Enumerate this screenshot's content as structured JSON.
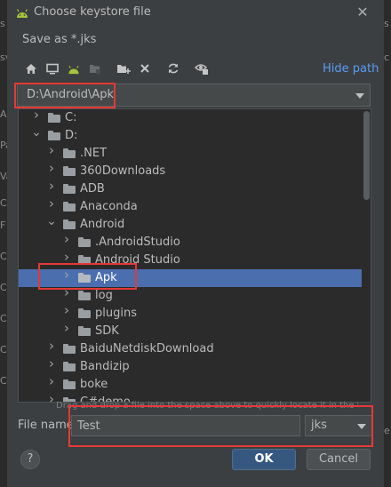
{
  "window": {
    "title": "Choose keystore file",
    "close_icon": "close-icon"
  },
  "subtitle": "Save as *.jks",
  "toolbar": {
    "buttons": [
      "home-icon",
      "desktop-icon",
      "android-icon",
      "module-icon",
      "new-folder-icon",
      "delete-icon",
      "refresh-icon",
      "show-hidden-icon"
    ],
    "hide_path": "Hide path"
  },
  "path": {
    "value": "D:\\Android\\Apk"
  },
  "tree": {
    "items": [
      {
        "label": "C:",
        "depth": 0,
        "expanded": false,
        "selected": false
      },
      {
        "label": "D:",
        "depth": 0,
        "expanded": true,
        "selected": false
      },
      {
        "label": ".NET",
        "depth": 1,
        "expanded": false,
        "selected": false
      },
      {
        "label": "360Downloads",
        "depth": 1,
        "expanded": false,
        "selected": false
      },
      {
        "label": "ADB",
        "depth": 1,
        "expanded": false,
        "selected": false
      },
      {
        "label": "Anaconda",
        "depth": 1,
        "expanded": false,
        "selected": false
      },
      {
        "label": "Android",
        "depth": 1,
        "expanded": true,
        "selected": false
      },
      {
        "label": ".AndroidStudio",
        "depth": 2,
        "expanded": false,
        "selected": false
      },
      {
        "label": "Android Studio",
        "depth": 2,
        "expanded": false,
        "selected": false
      },
      {
        "label": "Apk",
        "depth": 2,
        "expanded": false,
        "selected": true
      },
      {
        "label": "log",
        "depth": 2,
        "expanded": false,
        "selected": false
      },
      {
        "label": "plugins",
        "depth": 2,
        "expanded": false,
        "selected": false
      },
      {
        "label": "SDK",
        "depth": 2,
        "expanded": false,
        "selected": false
      },
      {
        "label": "BaiduNetdiskDownload",
        "depth": 1,
        "expanded": false,
        "selected": false
      },
      {
        "label": "Bandizip",
        "depth": 1,
        "expanded": false,
        "selected": false
      },
      {
        "label": "boke",
        "depth": 1,
        "expanded": false,
        "selected": false
      },
      {
        "label": "C#demo",
        "depth": 1,
        "expanded": false,
        "selected": false
      }
    ]
  },
  "hint": "Drag and drop a file into the space above to quickly locate it in the tree",
  "file_name": {
    "label": "File name:",
    "value": "Test"
  },
  "extension": {
    "value": "jks"
  },
  "buttons": {
    "help": "?",
    "ok": "OK",
    "cancel": "Cancel"
  },
  "left_edge": [
    "s",
    "sv",
    "Al",
    "Pa",
    "Va",
    "C",
    "F",
    "C",
    "C",
    "C",
    "C",
    "C"
  ],
  "right_edge": [
    "s",
    "c",
    "e"
  ],
  "colors": {
    "accent": "#4b6eaf",
    "link": "#589df6",
    "highlight": "#e53935",
    "android": "#a4c639"
  }
}
